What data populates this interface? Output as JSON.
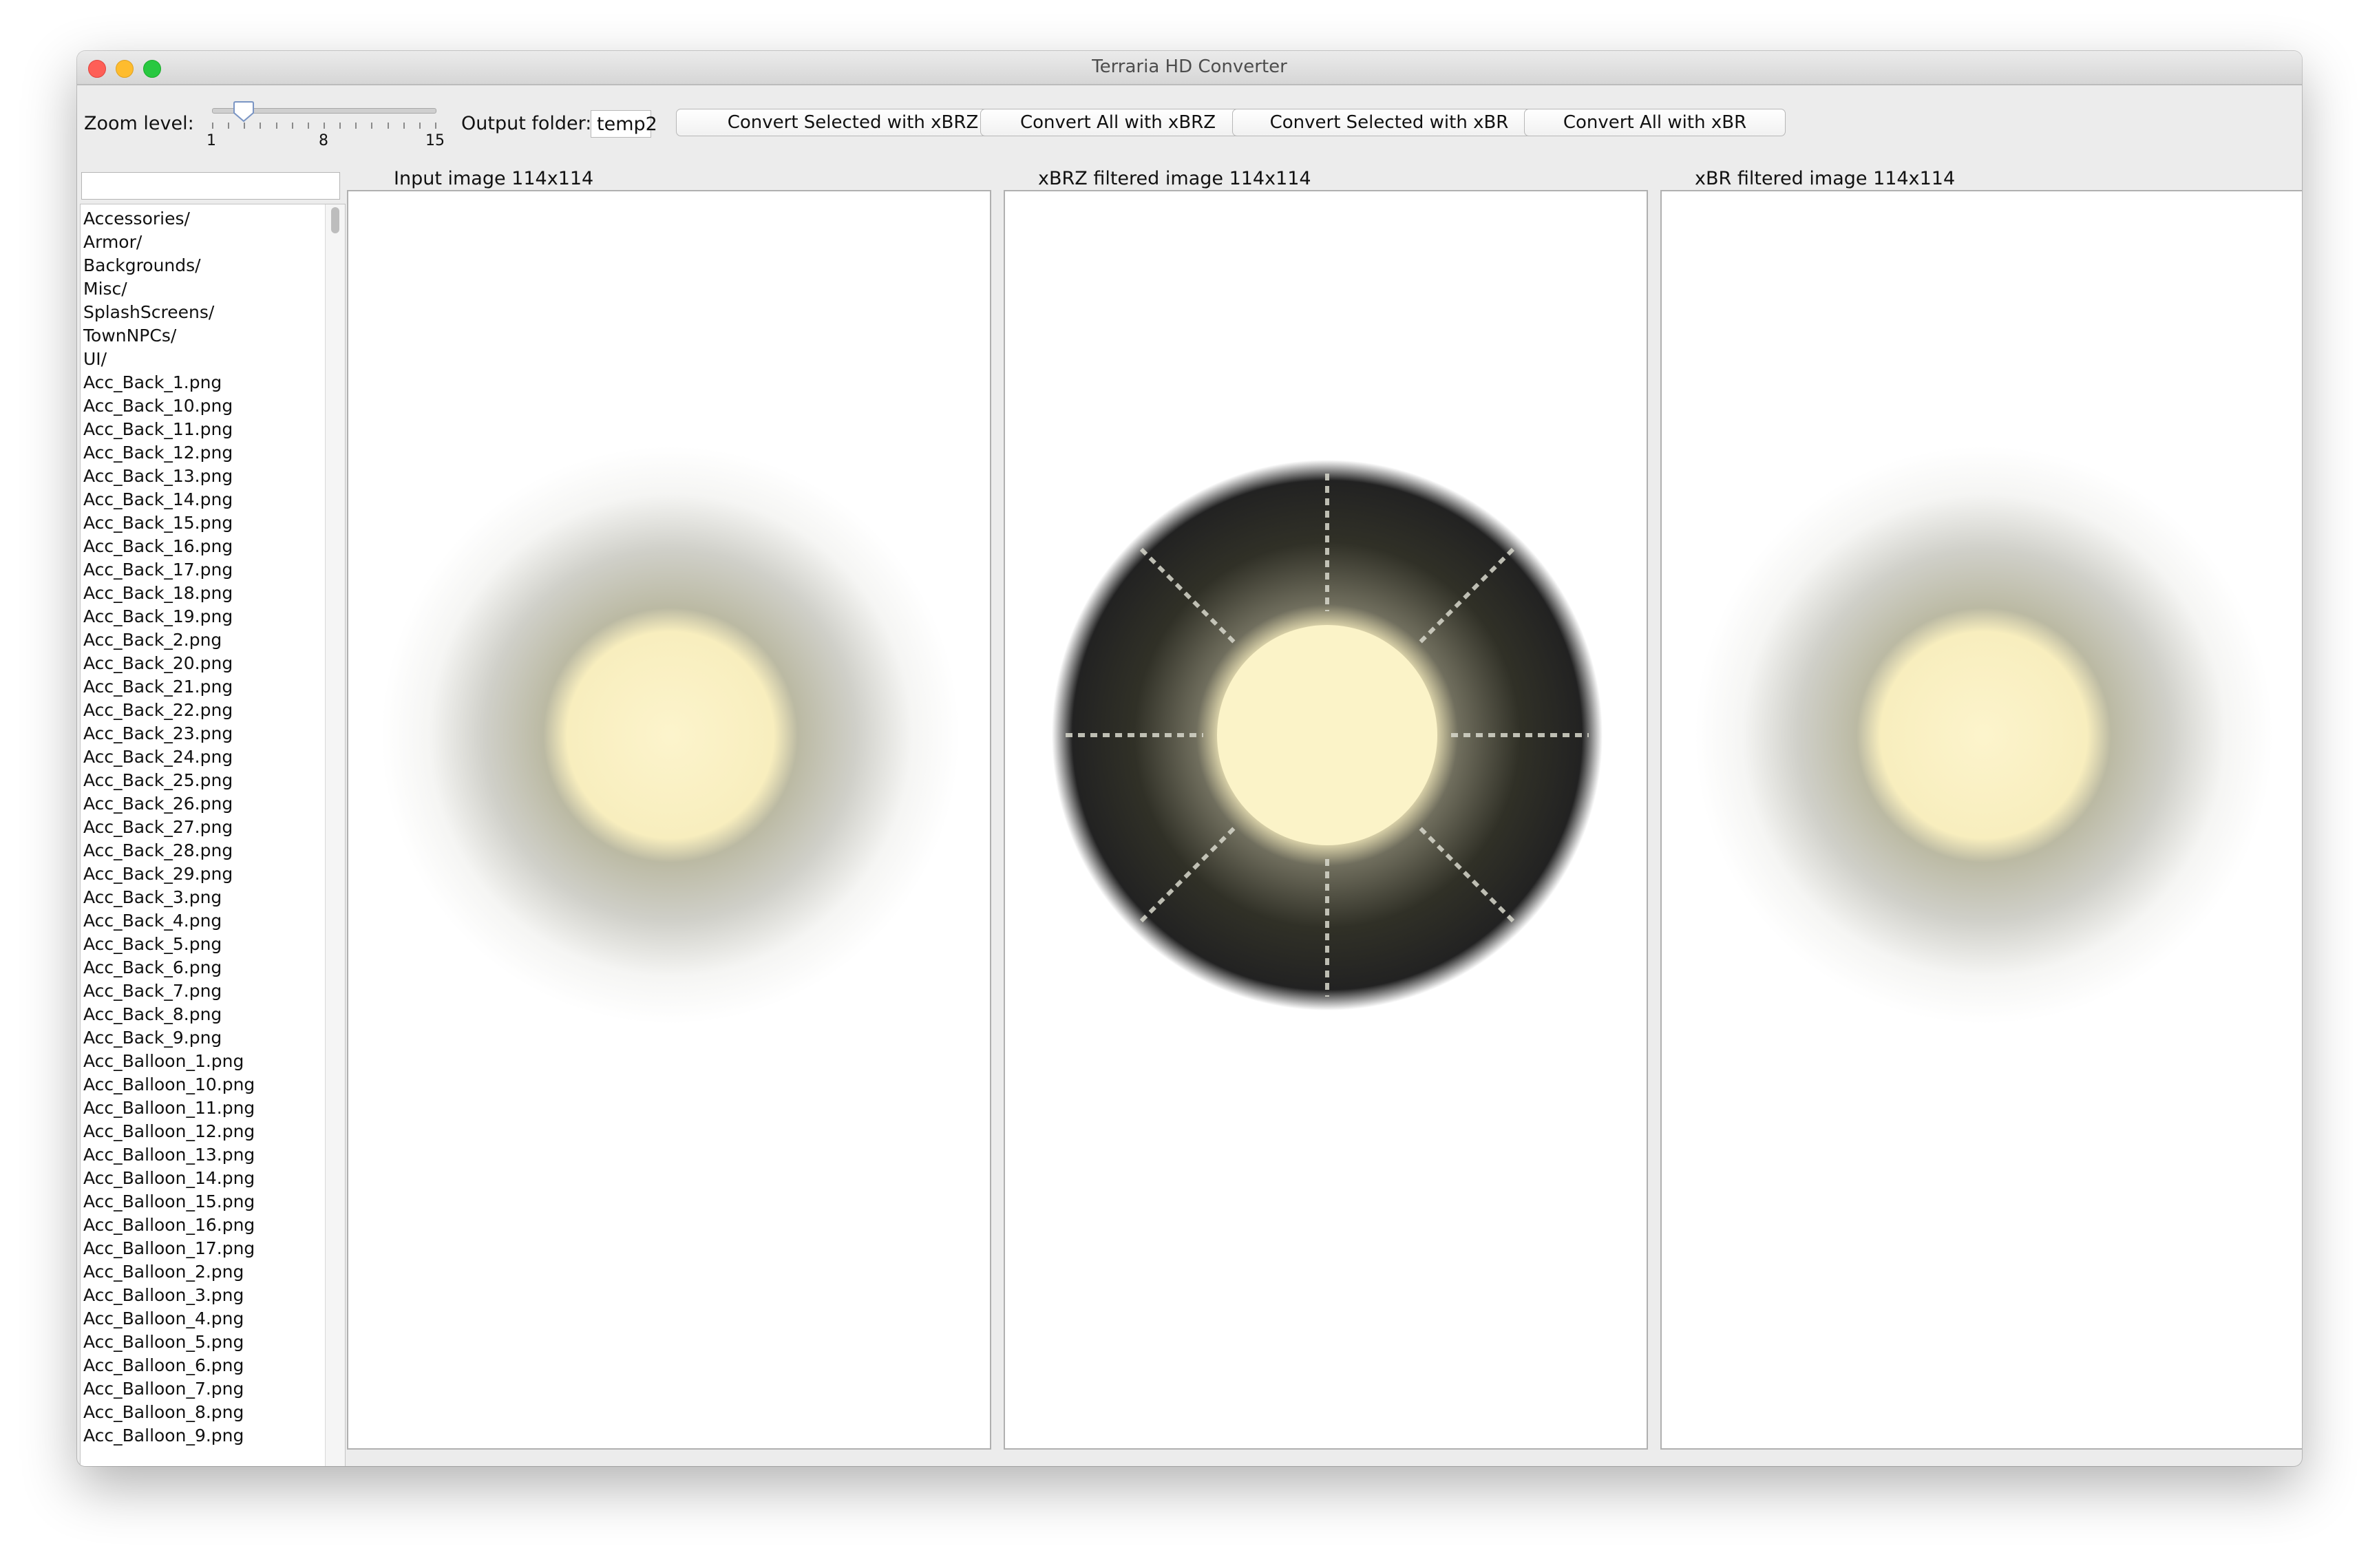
{
  "window": {
    "title": "Terraria HD Converter"
  },
  "toolbar": {
    "zoom_label": "Zoom level:",
    "zoom": {
      "min": 1,
      "max": 15,
      "value": 3,
      "tick_labels": [
        "1",
        "8",
        "15"
      ]
    },
    "output_folder_label": "Output folder:",
    "output_folder_value": "temp2",
    "buttons": [
      "Convert Selected with xBRZ",
      "Convert All with xBRZ",
      "Convert Selected with xBR",
      "Convert All with xBR"
    ]
  },
  "search": {
    "value": ""
  },
  "file_list": [
    "Accessories/",
    "Armor/",
    "Backgrounds/",
    "Misc/",
    "SplashScreens/",
    "TownNPCs/",
    "UI/",
    "Acc_Back_1.png",
    "Acc_Back_10.png",
    "Acc_Back_11.png",
    "Acc_Back_12.png",
    "Acc_Back_13.png",
    "Acc_Back_14.png",
    "Acc_Back_15.png",
    "Acc_Back_16.png",
    "Acc_Back_17.png",
    "Acc_Back_18.png",
    "Acc_Back_19.png",
    "Acc_Back_2.png",
    "Acc_Back_20.png",
    "Acc_Back_21.png",
    "Acc_Back_22.png",
    "Acc_Back_23.png",
    "Acc_Back_24.png",
    "Acc_Back_25.png",
    "Acc_Back_26.png",
    "Acc_Back_27.png",
    "Acc_Back_28.png",
    "Acc_Back_29.png",
    "Acc_Back_3.png",
    "Acc_Back_4.png",
    "Acc_Back_5.png",
    "Acc_Back_6.png",
    "Acc_Back_7.png",
    "Acc_Back_8.png",
    "Acc_Back_9.png",
    "Acc_Balloon_1.png",
    "Acc_Balloon_10.png",
    "Acc_Balloon_11.png",
    "Acc_Balloon_12.png",
    "Acc_Balloon_13.png",
    "Acc_Balloon_14.png",
    "Acc_Balloon_15.png",
    "Acc_Balloon_16.png",
    "Acc_Balloon_17.png",
    "Acc_Balloon_2.png",
    "Acc_Balloon_3.png",
    "Acc_Balloon_4.png",
    "Acc_Balloon_5.png",
    "Acc_Balloon_6.png",
    "Acc_Balloon_7.png",
    "Acc_Balloon_8.png",
    "Acc_Balloon_9.png"
  ],
  "panels": [
    {
      "label": "Input image 114x114",
      "icon": "input-image-preview"
    },
    {
      "label": "xBRZ filtered image 114x114",
      "icon": "xbrz-image-preview"
    },
    {
      "label": "xBR filtered image 114x114",
      "icon": "xbr-image-preview"
    }
  ],
  "colors": {
    "glow_core": "#fbf3c8",
    "xbrz_halo": "#111111",
    "window_bg": "#ececec"
  }
}
